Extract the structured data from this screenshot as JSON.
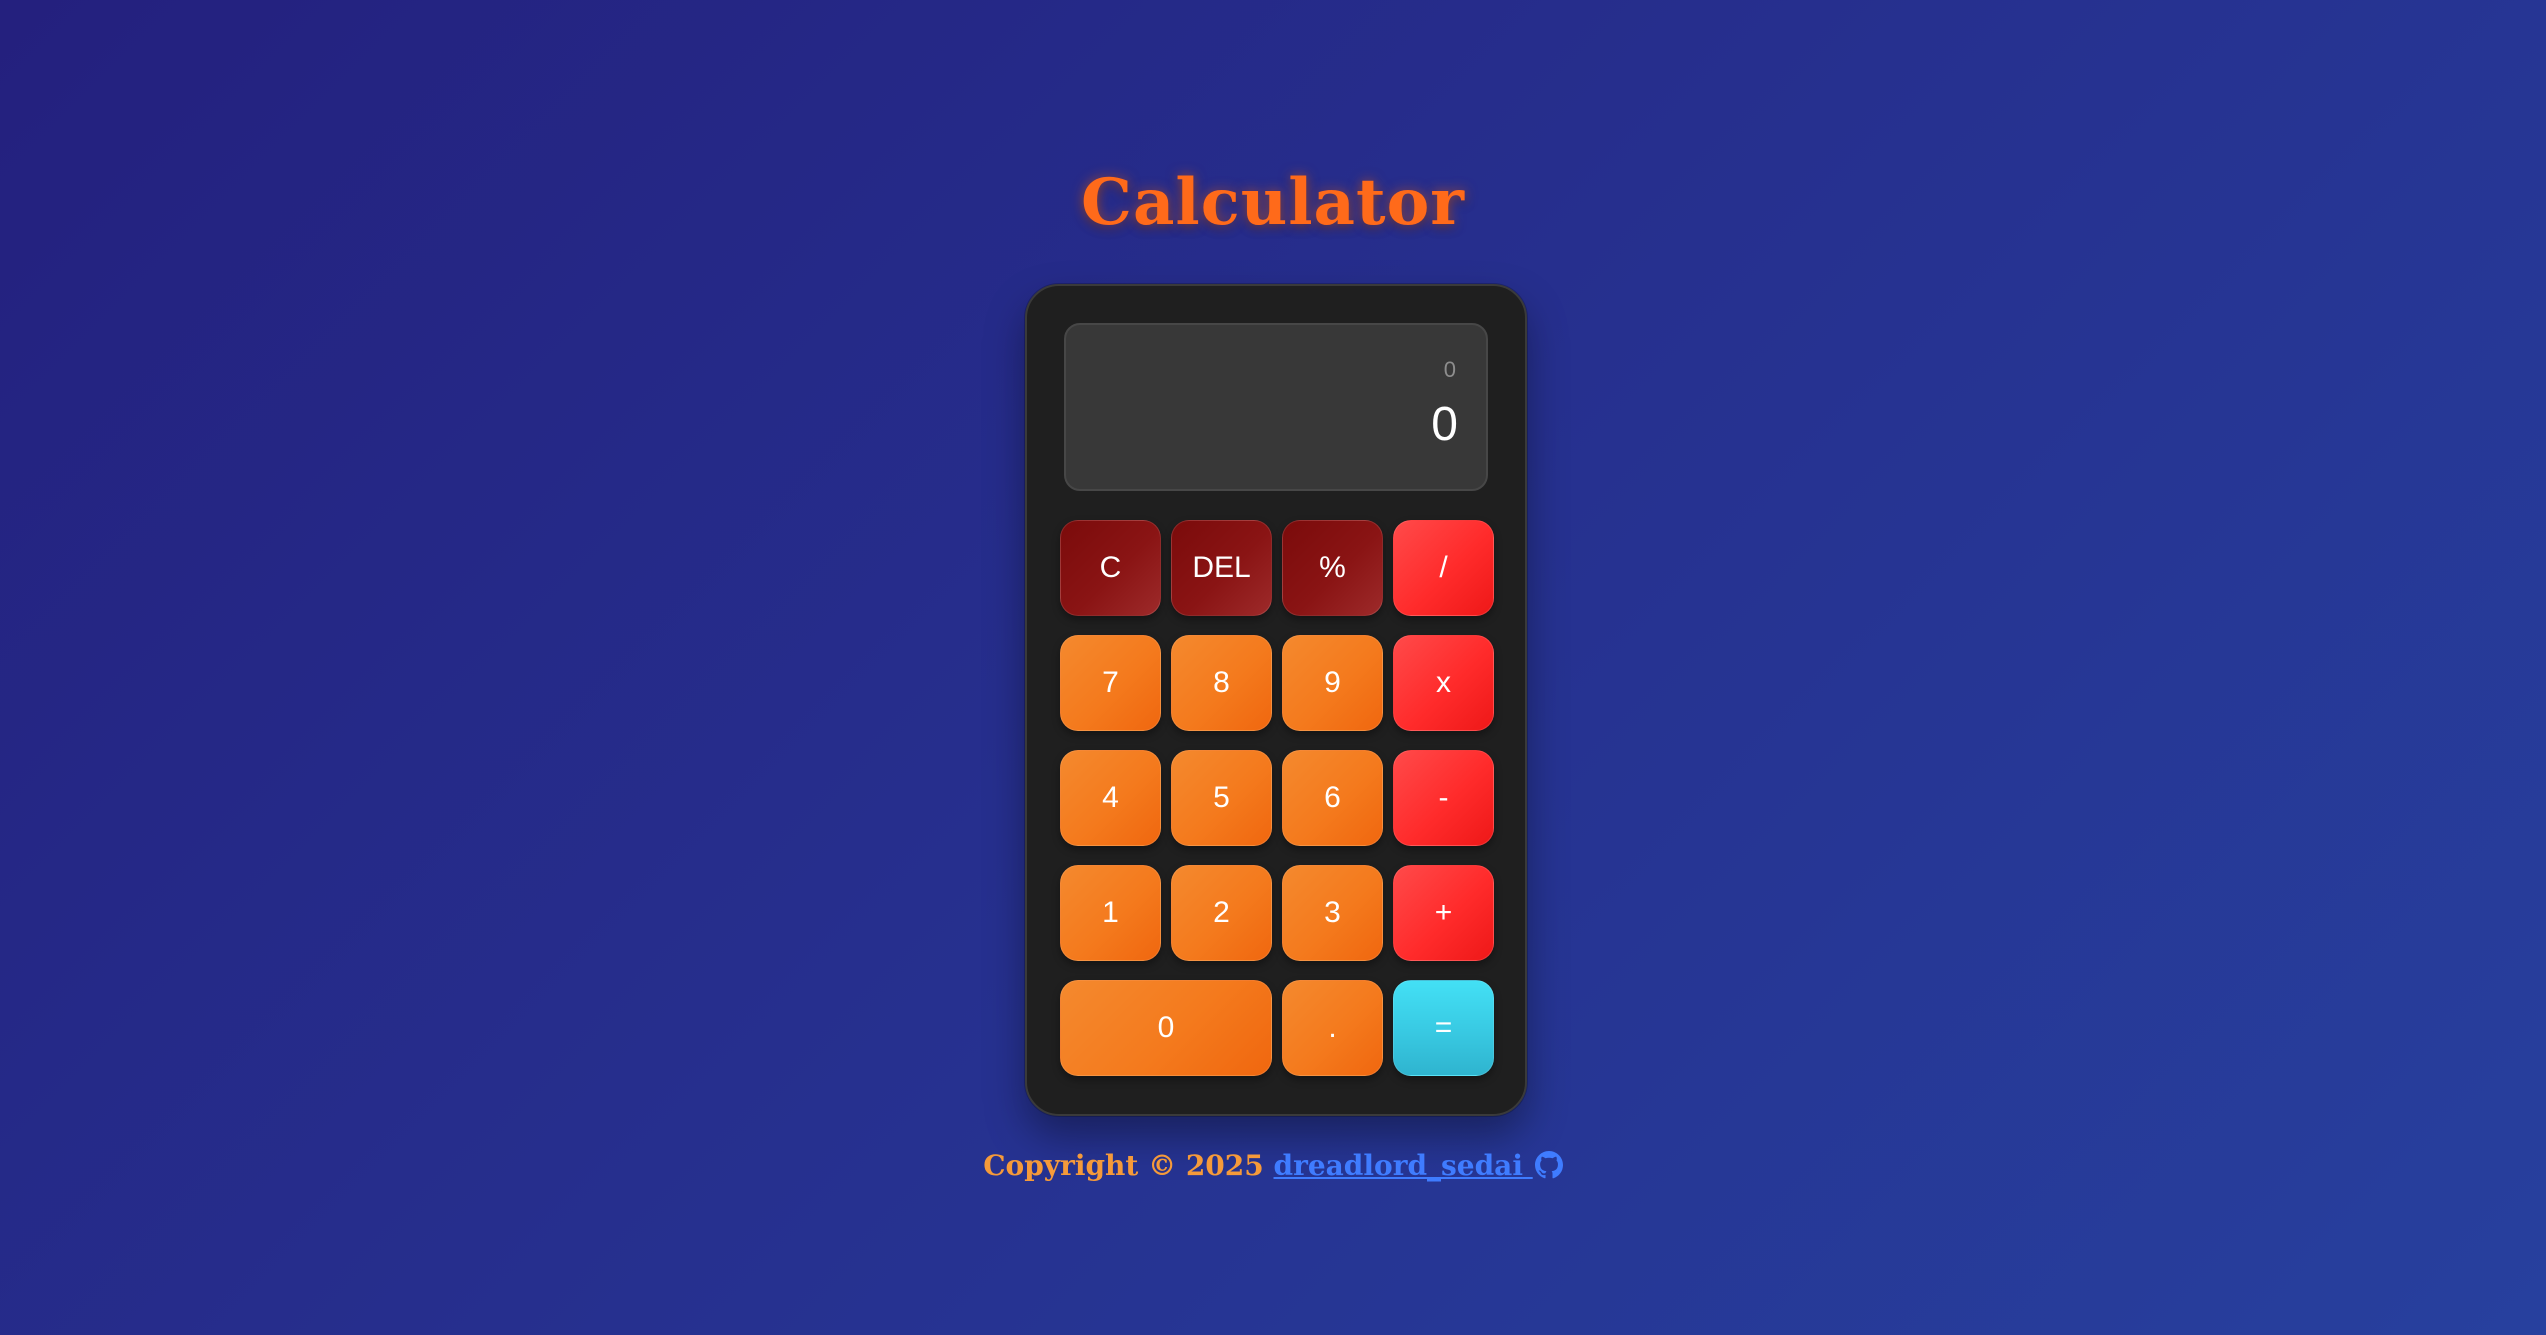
{
  "app": {
    "title": "Calculator"
  },
  "display": {
    "previous": "0",
    "current": "0"
  },
  "keys": {
    "clear": "C",
    "delete": "DEL",
    "percent": "%",
    "divide": "/",
    "seven": "7",
    "eight": "8",
    "nine": "9",
    "multiply": "x",
    "four": "4",
    "five": "5",
    "six": "6",
    "subtract": "-",
    "one": "1",
    "two": "2",
    "three": "3",
    "add": "+",
    "zero": "0",
    "decimal": ".",
    "equals": "="
  },
  "footer": {
    "copyright": "Copyright © 2025",
    "author": "dreadlord_sedai",
    "icon": "github-icon"
  },
  "colors": {
    "title": "#ff6a1a",
    "number_key": "#f47a1d",
    "function_key": "#8a1414",
    "operator_key": "#ff2b2b",
    "equals_key": "#38c9e2",
    "link": "#3f7cff",
    "footer_text": "#f59a3a"
  }
}
